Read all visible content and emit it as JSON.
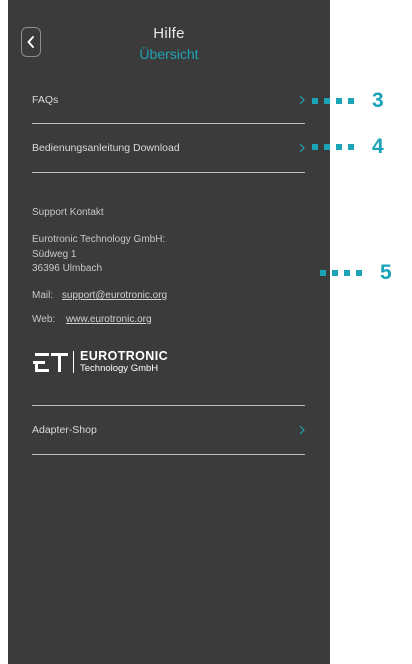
{
  "header": {
    "back_icon": "chevron-left-icon",
    "title": "Hilfe",
    "subtitle": "Übersicht"
  },
  "menu": {
    "faqs": "FAQs",
    "manual_download": "Bedienungsanleitung Download",
    "adapter_shop": "Adapter-Shop",
    "chevron_icon": "chevron-right-icon"
  },
  "support": {
    "heading": "Support Kontakt",
    "company": "Eurotronic Technology GmbH:",
    "street": "Südweg 1",
    "city": "36396 Ulmbach",
    "mail_label": "Mail:",
    "mail_value": "support@eurotronic.org",
    "web_label": "Web:",
    "web_value": "www.eurotronic.org"
  },
  "logo": {
    "brand": "EUROTRONIC",
    "tagline": "Technology GmbH"
  },
  "annotations": {
    "faqs": "3",
    "manual_download": "4",
    "support": "5"
  },
  "colors": {
    "background": "#3b3b3b",
    "accent": "#1fa3b6",
    "annotation": "#1ba3b8"
  }
}
